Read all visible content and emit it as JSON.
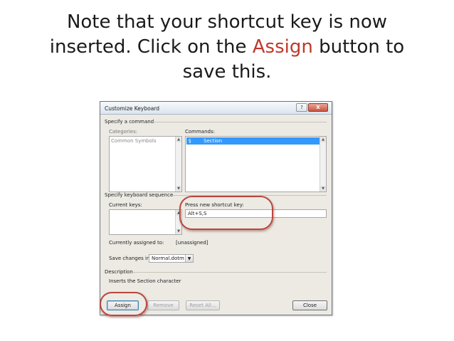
{
  "caption": {
    "line1": "Note that your shortcut key is now",
    "line2_before": "inserted.  Click on the ",
    "line2_accent": "Assign",
    "line2_after": " button to",
    "line3": "save this.",
    "accent_color": "#c0392b"
  },
  "dialog": {
    "title": "Customize Keyboard",
    "help_glyph": "?",
    "close_glyph": "X",
    "specify_command_label": "Specify a command",
    "categories_label": "Categories:",
    "categories_items": [
      "Common Symbols"
    ],
    "commands_label": "Commands:",
    "commands_selected": {
      "symbol": "§",
      "name": "Section"
    },
    "keyboard_sequence_label": "Specify keyboard sequence",
    "current_keys_label": "Current keys:",
    "new_shortcut_label": "Press new shortcut key:",
    "new_shortcut_value": "Alt+S,S",
    "currently_assigned_label": "Currently assigned to:",
    "currently_assigned_value": "[unassigned]",
    "save_changes_label": "Save changes in:",
    "save_changes_value": "Normal.dotm",
    "description_label": "Description",
    "description_text": "Inserts the Section character",
    "buttons": {
      "assign": "Assign",
      "remove": "Remove",
      "reset_all": "Reset All...",
      "close": "Close"
    },
    "scroll_up_glyph": "▲",
    "scroll_down_glyph": "▼",
    "dropdown_glyph": "▼"
  },
  "highlight_color": "#b8473f"
}
